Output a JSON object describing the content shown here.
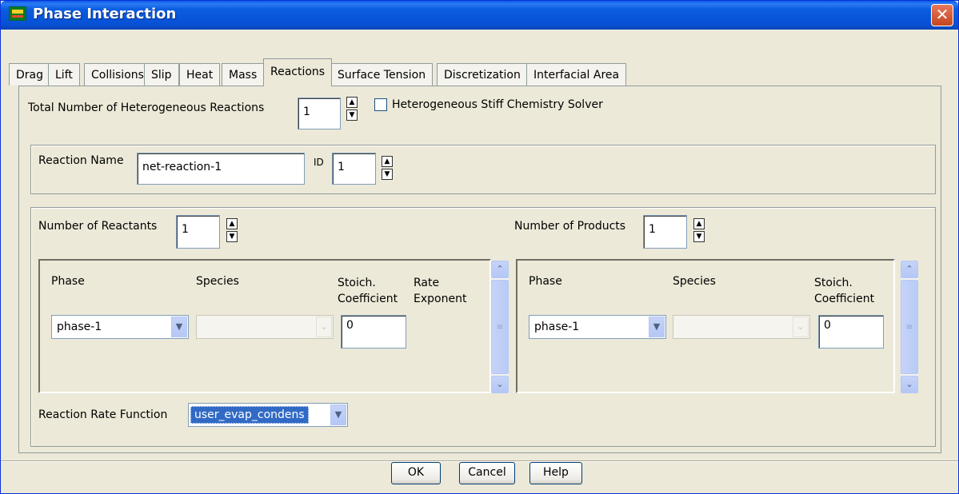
{
  "window": {
    "title": "Phase Interaction",
    "close_glyph": "✕"
  },
  "tabs": [
    "Drag",
    "Lift",
    "Collisions",
    "Slip",
    "Heat",
    "Mass",
    "Reactions",
    "Surface Tension",
    "Discretization",
    "Interfacial Area"
  ],
  "active_tab": "Reactions",
  "total_reactions": {
    "label": "Total Number of Heterogeneous Reactions",
    "value": "1"
  },
  "stiff_solver": {
    "label": "Heterogeneous Stiff Chemistry Solver",
    "checked": false
  },
  "reaction": {
    "name_label": "Reaction Name",
    "name_value": "net-reaction-1",
    "id_label": "ID",
    "id_value": "1"
  },
  "reactants": {
    "count_label": "Number of Reactants",
    "count_value": "1",
    "headers": {
      "phase": "Phase",
      "species": "Species",
      "stoich": "Stoich.\nCoefficient",
      "rate": "Rate\nExponent"
    },
    "row": {
      "phase": "phase-1",
      "species": "",
      "stoich": "0"
    }
  },
  "products": {
    "count_label": "Number of Products",
    "count_value": "1",
    "headers": {
      "phase": "Phase",
      "species": "Species",
      "stoich": "Stoich.\nCoefficient"
    },
    "row": {
      "phase": "phase-1",
      "species": "",
      "stoich": "0"
    }
  },
  "rate_function": {
    "label": "Reaction Rate Function",
    "value": "user_evap_condens"
  },
  "buttons": {
    "ok": "OK",
    "cancel": "Cancel",
    "help": "Help"
  }
}
